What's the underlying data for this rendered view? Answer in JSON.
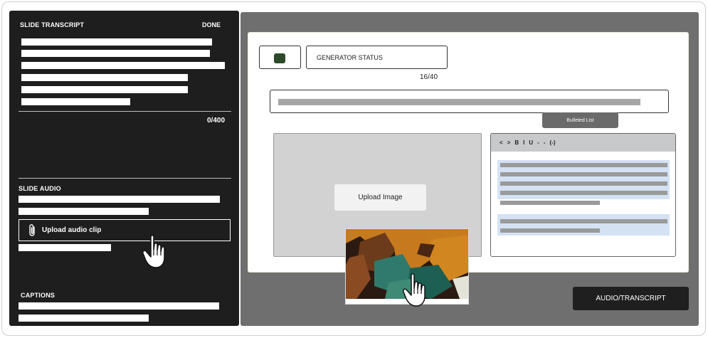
{
  "left_panel": {
    "transcript_label": "SLIDE TRANSCRIPT",
    "done_label": "DONE",
    "transcript_counter": "0/400",
    "audio_label": "SLIDE AUDIO",
    "upload_audio_label": "Upload audio clip",
    "captions_label": "CAPTIONS"
  },
  "editor": {
    "status_field_value": "GENERATOR STATUS",
    "status_counter": "16/40",
    "tooltip_label": "Bulleted List",
    "upload_image_label": "Upload Image",
    "toolbar": [
      "<",
      ">",
      "B",
      "I",
      "U",
      "-",
      "-",
      "(-)"
    ]
  },
  "footer": {
    "audio_transcript_label": "AUDIO/TRANSCRIPT"
  },
  "colors": {
    "left_panel_bg": "#1e1e1e",
    "workspace_bg": "#6f6f6f",
    "swatch": "#2c4a2a",
    "highlight": "#d4e2f4"
  },
  "icons": [
    "paperclip-icon",
    "pointer-hand-icon",
    "color-swatch-icon"
  ]
}
